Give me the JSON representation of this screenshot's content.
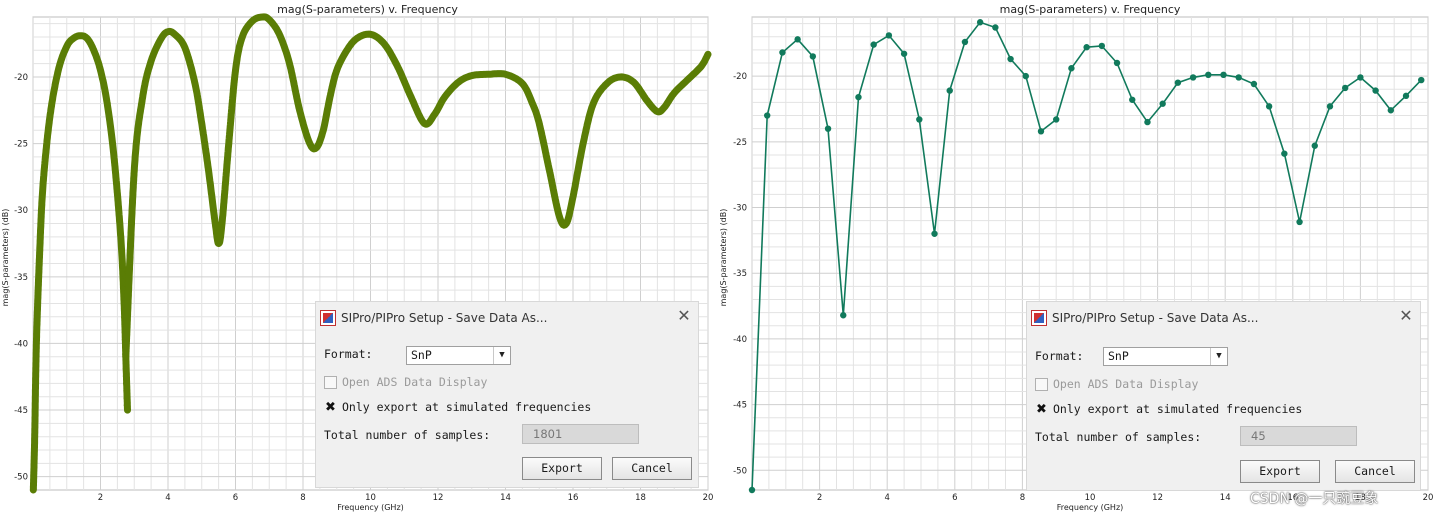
{
  "colors": {
    "left_line": "#5a7d05",
    "right_line": "#117a5c",
    "grid": "#e3e3e3",
    "grid_major": "#cfcfcf"
  },
  "chart_data": [
    {
      "type": "line",
      "title": "mag(S-parameters) v. Frequency",
      "xlabel": "Frequency (GHz)",
      "ylabel": "mag(S-parameters) (dB)",
      "xlim": [
        0,
        20
      ],
      "ylim": [
        -51,
        -15.5
      ],
      "xticks": [
        2,
        4,
        6,
        8,
        10,
        12,
        14,
        16,
        18,
        20
      ],
      "yticks": [
        -20,
        -25,
        -30,
        -35,
        -40,
        -45,
        -50
      ],
      "grid": true,
      "markers": "dense",
      "series": [
        {
          "x": [
            0.01,
            0.05,
            0.1,
            0.2,
            0.3,
            0.5,
            0.75,
            1.0,
            1.2,
            1.4,
            1.6,
            1.8,
            2.0,
            2.2,
            2.4,
            2.6,
            2.7,
            2.75,
            2.8
          ],
          "y": [
            -51,
            -47,
            -40,
            -33,
            -28,
            -23,
            -19.5,
            -17.7,
            -17.1,
            -16.9,
            -17.1,
            -18,
            -19.5,
            -22,
            -26,
            -32,
            -37,
            -41,
            -45
          ]
        },
        {
          "x": [
            2.75,
            3.0,
            3.25,
            3.5,
            3.8,
            4.0,
            4.2,
            4.5,
            4.8,
            5.0,
            5.2,
            5.4,
            5.5,
            5.6,
            5.8,
            6.0,
            6.2,
            6.5,
            6.8,
            7.0,
            7.3,
            7.6,
            7.9,
            8.2,
            8.4,
            8.6,
            8.8,
            9.0,
            9.3,
            9.6,
            10.0,
            10.4,
            10.8,
            11.2,
            11.6,
            11.9,
            12.2,
            12.6,
            13.0,
            13.5,
            14.0,
            14.5,
            14.8,
            15.0,
            15.3,
            15.6,
            15.8,
            16.0,
            16.3,
            16.6,
            17.0,
            17.4,
            17.8,
            18.2,
            18.5,
            18.7,
            19.0,
            19.4,
            19.8,
            20.0
          ],
          "y": [
            -41,
            -27,
            -21.5,
            -18.8,
            -17.1,
            -16.6,
            -16.8,
            -17.8,
            -20.5,
            -23.5,
            -27,
            -31,
            -32.5,
            -31,
            -25,
            -19.5,
            -17,
            -15.8,
            -15.5,
            -15.7,
            -16.8,
            -19,
            -22.5,
            -25,
            -25.3,
            -24,
            -21.5,
            -19.5,
            -18,
            -17.1,
            -16.8,
            -17.5,
            -19.2,
            -21.5,
            -23.5,
            -22.8,
            -21.5,
            -20.4,
            -19.9,
            -19.8,
            -19.8,
            -20.5,
            -22,
            -23.5,
            -27,
            -30.5,
            -31,
            -29,
            -25,
            -22,
            -20.5,
            -20.0,
            -20.4,
            -21.8,
            -22.6,
            -22.3,
            -21.2,
            -20.2,
            -19.2,
            -18.3
          ]
        }
      ]
    },
    {
      "type": "line",
      "title": "mag(S-parameters) v. Frequency",
      "xlabel": "Frequency (GHz)",
      "ylabel": "mag(S-parameters) (dB)",
      "xlim": [
        0,
        20
      ],
      "ylim": [
        -51.5,
        -15.5
      ],
      "xticks": [
        2,
        4,
        6,
        8,
        10,
        12,
        14,
        16,
        18,
        20
      ],
      "yticks": [
        -20,
        -25,
        -30,
        -35,
        -40,
        -45,
        -50
      ],
      "grid": true,
      "markers": "points",
      "series": [
        {
          "x": [
            0.0,
            0.45,
            0.9,
            1.35,
            1.8,
            2.25,
            2.7,
            3.15,
            3.6,
            4.05,
            4.5,
            4.95,
            5.4,
            5.85,
            6.3,
            6.75,
            7.2,
            7.65,
            8.1,
            8.55,
            9.0,
            9.45,
            9.9,
            10.35,
            10.8,
            11.25,
            11.7,
            12.15,
            12.6,
            13.05,
            13.5,
            13.95,
            14.4,
            14.85,
            15.3,
            15.75,
            16.2,
            16.65,
            17.1,
            17.55,
            18.0,
            18.45,
            18.9,
            19.35,
            19.8
          ],
          "y": [
            -51.5,
            -23,
            -18.2,
            -17.2,
            -18.5,
            -24,
            -38.2,
            -21.6,
            -17.6,
            -16.9,
            -18.3,
            -23.3,
            -32,
            -21.1,
            -17.4,
            -15.9,
            -16.3,
            -18.7,
            -20,
            -24.2,
            -23.3,
            -19.4,
            -17.8,
            -17.7,
            -19,
            -21.8,
            -23.5,
            -22.1,
            -20.5,
            -20.1,
            -19.9,
            -19.9,
            -20.1,
            -20.6,
            -22.3,
            -25.9,
            -31.1,
            -25.3,
            -22.3,
            -20.9,
            -20.1,
            -21.1,
            -22.6,
            -21.5,
            -20.3
          ]
        }
      ]
    }
  ],
  "dialogs": [
    {
      "title": "SIPro/PIPro Setup - Save Data As...",
      "format_label": "Format:",
      "format_value": "SnP",
      "open_ads_label": "Open ADS Data Display",
      "open_ads_checked": false,
      "only_export_label": "Only export at simulated frequencies",
      "only_export_checked": true,
      "checkmark": "✖",
      "samples_label": "Total number of samples:",
      "samples_value": "1801",
      "export_label": "Export",
      "cancel_label": "Cancel"
    },
    {
      "title": "SIPro/PIPro Setup - Save Data As...",
      "format_label": "Format:",
      "format_value": "SnP",
      "open_ads_label": "Open ADS Data Display",
      "open_ads_checked": false,
      "only_export_label": "Only export at simulated frequencies",
      "only_export_checked": true,
      "checkmark": "✖",
      "samples_label": "Total number of samples:",
      "samples_value": "45",
      "export_label": "Export",
      "cancel_label": "Cancel"
    }
  ],
  "watermark": "CSDN @一只豌豆象"
}
